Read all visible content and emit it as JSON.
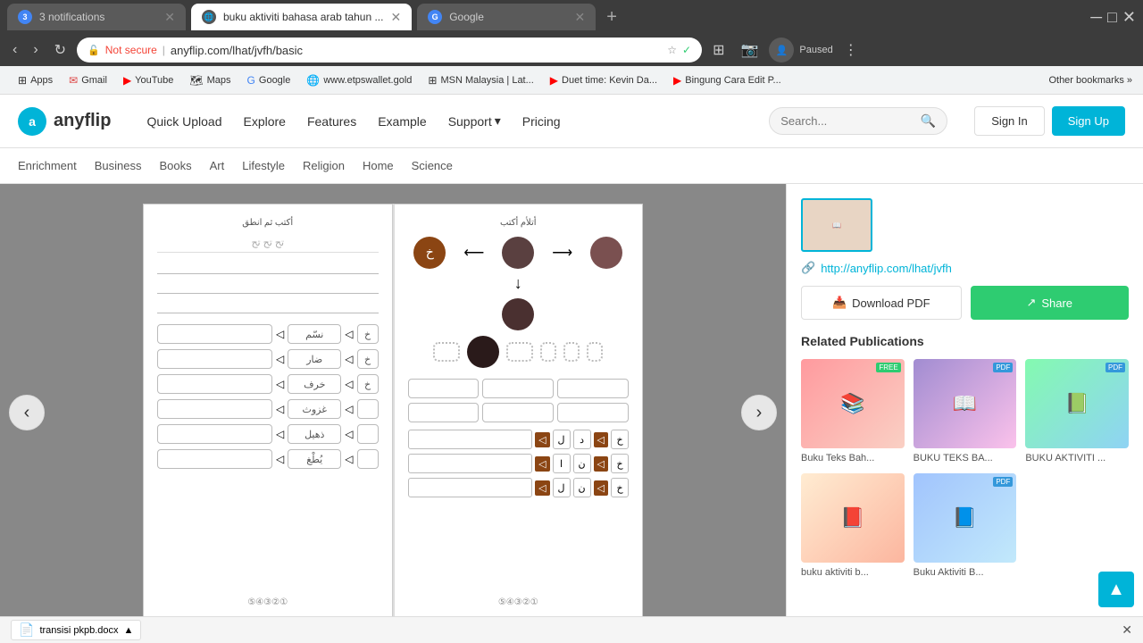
{
  "browser": {
    "tabs": [
      {
        "id": "tab1",
        "title": "3 notifications",
        "active": false,
        "favicon_type": "notification"
      },
      {
        "id": "tab2",
        "title": "buku aktiviti bahasa arab tahun ...",
        "active": true,
        "favicon_type": "globe"
      },
      {
        "id": "tab3",
        "title": "Google",
        "active": false,
        "favicon_type": "google"
      }
    ],
    "url": "anyflip.com/lhat/jvfh/basic",
    "url_display": "anyflip.com/lhat/jvfh/basic",
    "security_label": "Not secure",
    "profile_label": "Paused"
  },
  "bookmarks": [
    {
      "label": "Apps",
      "icon": "⊞"
    },
    {
      "label": "Gmail",
      "icon": "✉"
    },
    {
      "label": "YouTube",
      "icon": "▶"
    },
    {
      "label": "Maps",
      "icon": "🗺"
    },
    {
      "label": "Google",
      "icon": "G"
    },
    {
      "label": "www.etpswallet.gold",
      "icon": "🌐"
    },
    {
      "label": "MSN Malaysia | Lat...",
      "icon": "⊞"
    },
    {
      "label": "Duet time: Kevin Da...",
      "icon": "▶"
    },
    {
      "label": "Bingung Cara Edit P...",
      "icon": "▶"
    }
  ],
  "header": {
    "logo_letter": "a",
    "logo_name": "anyflip",
    "nav": [
      {
        "label": "Quick Upload",
        "active": false
      },
      {
        "label": "Explore",
        "active": false
      },
      {
        "label": "Features",
        "active": false
      },
      {
        "label": "Example",
        "active": false
      },
      {
        "label": "Support",
        "has_dropdown": true
      },
      {
        "label": "Pricing",
        "active": false
      }
    ],
    "search_placeholder": "Search...",
    "signin_label": "Sign In",
    "signup_label": "Sign Up"
  },
  "categories": [
    "Enrichment",
    "Business",
    "Books",
    "Art",
    "Lifestyle",
    "Religion",
    "Home",
    "Science"
  ],
  "sidebar": {
    "link_text": "http://anyflip.com/lhat/jvfh",
    "download_label": "Download PDF",
    "share_label": "Share",
    "related_title": "Related Publications",
    "related_items": [
      {
        "label": "Buku Teks Bah...",
        "badge": "free",
        "badge_color": "green",
        "thumb_class": "thumb-1"
      },
      {
        "label": "BUKU TEKS BA...",
        "badge": "pdf",
        "badge_color": "blue",
        "thumb_class": "thumb-2"
      },
      {
        "label": "BUKU AKTIVITI ...",
        "badge": "pdf",
        "badge_color": "blue",
        "thumb_class": "thumb-3"
      },
      {
        "label": "buku aktiviti b...",
        "badge": "",
        "thumb_class": "thumb-4"
      },
      {
        "label": "Buku Aktiviti B...",
        "badge": "pdf",
        "badge_color": "blue",
        "thumb_class": "thumb-5"
      }
    ]
  },
  "bottom_bar": {
    "download_filename": "transisi pkpb.docx",
    "close_label": "✕"
  },
  "scroll_top_icon": "▲"
}
